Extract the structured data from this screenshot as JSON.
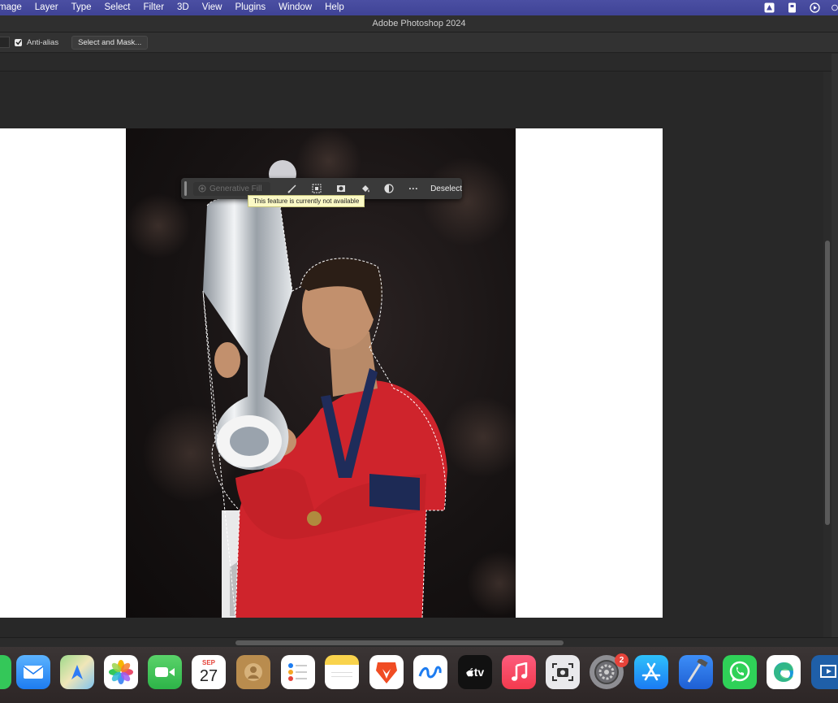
{
  "menubar": {
    "items": [
      "mage",
      "Layer",
      "Type",
      "Select",
      "Filter",
      "3D",
      "View",
      "Plugins",
      "Window",
      "Help"
    ]
  },
  "titlebar": {
    "title": "Adobe Photoshop 2024"
  },
  "options": {
    "antialias_label": "Anti-alias",
    "antialias_checked": true,
    "select_mask_label": "Select and Mask..."
  },
  "taskbar": {
    "generative_fill_label": "Generative Fill",
    "deselect_label": "Deselect",
    "more_label": "···",
    "tooltip": "This feature is currently not available"
  },
  "dock": {
    "calendar_month": "SEP",
    "calendar_day": "27",
    "settings_badge": "2",
    "appletv_label": "tv"
  },
  "colors": {
    "menubar": "#4446a0",
    "workspace": "#282828",
    "canvas": "#ffffff",
    "jersey": "#d4272f"
  }
}
